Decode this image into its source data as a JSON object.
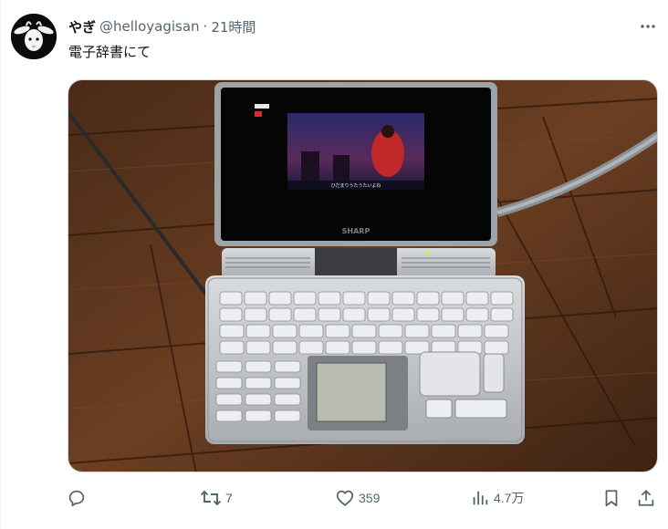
{
  "tweet": {
    "display_name": "やぎ",
    "handle": "@helloyagisan",
    "separator": "·",
    "time": "21時間",
    "text": "電子辞書にて"
  },
  "media": {
    "brand": "SHARP",
    "screen_caption": "ひだまりうたうたいよね"
  },
  "actions": {
    "reply_count": "",
    "retweet_count": "7",
    "like_count": "359",
    "view_count": "4.7万"
  },
  "colors": {
    "text_primary": "#0f1419",
    "text_secondary": "#536471",
    "border": "#eff3f4"
  },
  "icons": {
    "more": "more-horizontal-icon",
    "reply": "reply-bubble-icon",
    "retweet": "retweet-arrows-icon",
    "like": "heart-icon",
    "views": "bar-chart-icon",
    "bookmark": "bookmark-icon",
    "share": "share-upload-icon"
  }
}
